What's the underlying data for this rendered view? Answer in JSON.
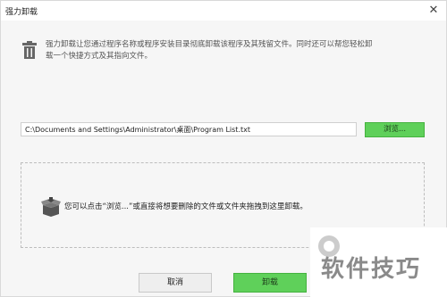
{
  "window": {
    "title": "强力卸载"
  },
  "header": {
    "icon": "trash-icon",
    "description_line1": "强力卸载让您通过程序名称或程序安装目录彻底卸载该程序及其残留文件。同时还可以帮您轻松卸",
    "description_line2": "载一个快捷方式及其指向文件。"
  },
  "path_field": {
    "value": "C:\\Documents and Settings\\Administrator\\桌面\\Program List.txt",
    "placeholder": ""
  },
  "browse_button": {
    "label": "浏览..."
  },
  "dropzone": {
    "icon": "open-box-icon",
    "text": "您可以点击“浏览...”或直接将想要删除的文件或文件夹拖拽到这里卸载。"
  },
  "footer": {
    "cancel_label": "取消",
    "uninstall_label": "卸载"
  },
  "watermark": {
    "text": "软件技巧"
  },
  "colors": {
    "accent_green": "#5fd05a",
    "background": "#f6f6f6"
  }
}
